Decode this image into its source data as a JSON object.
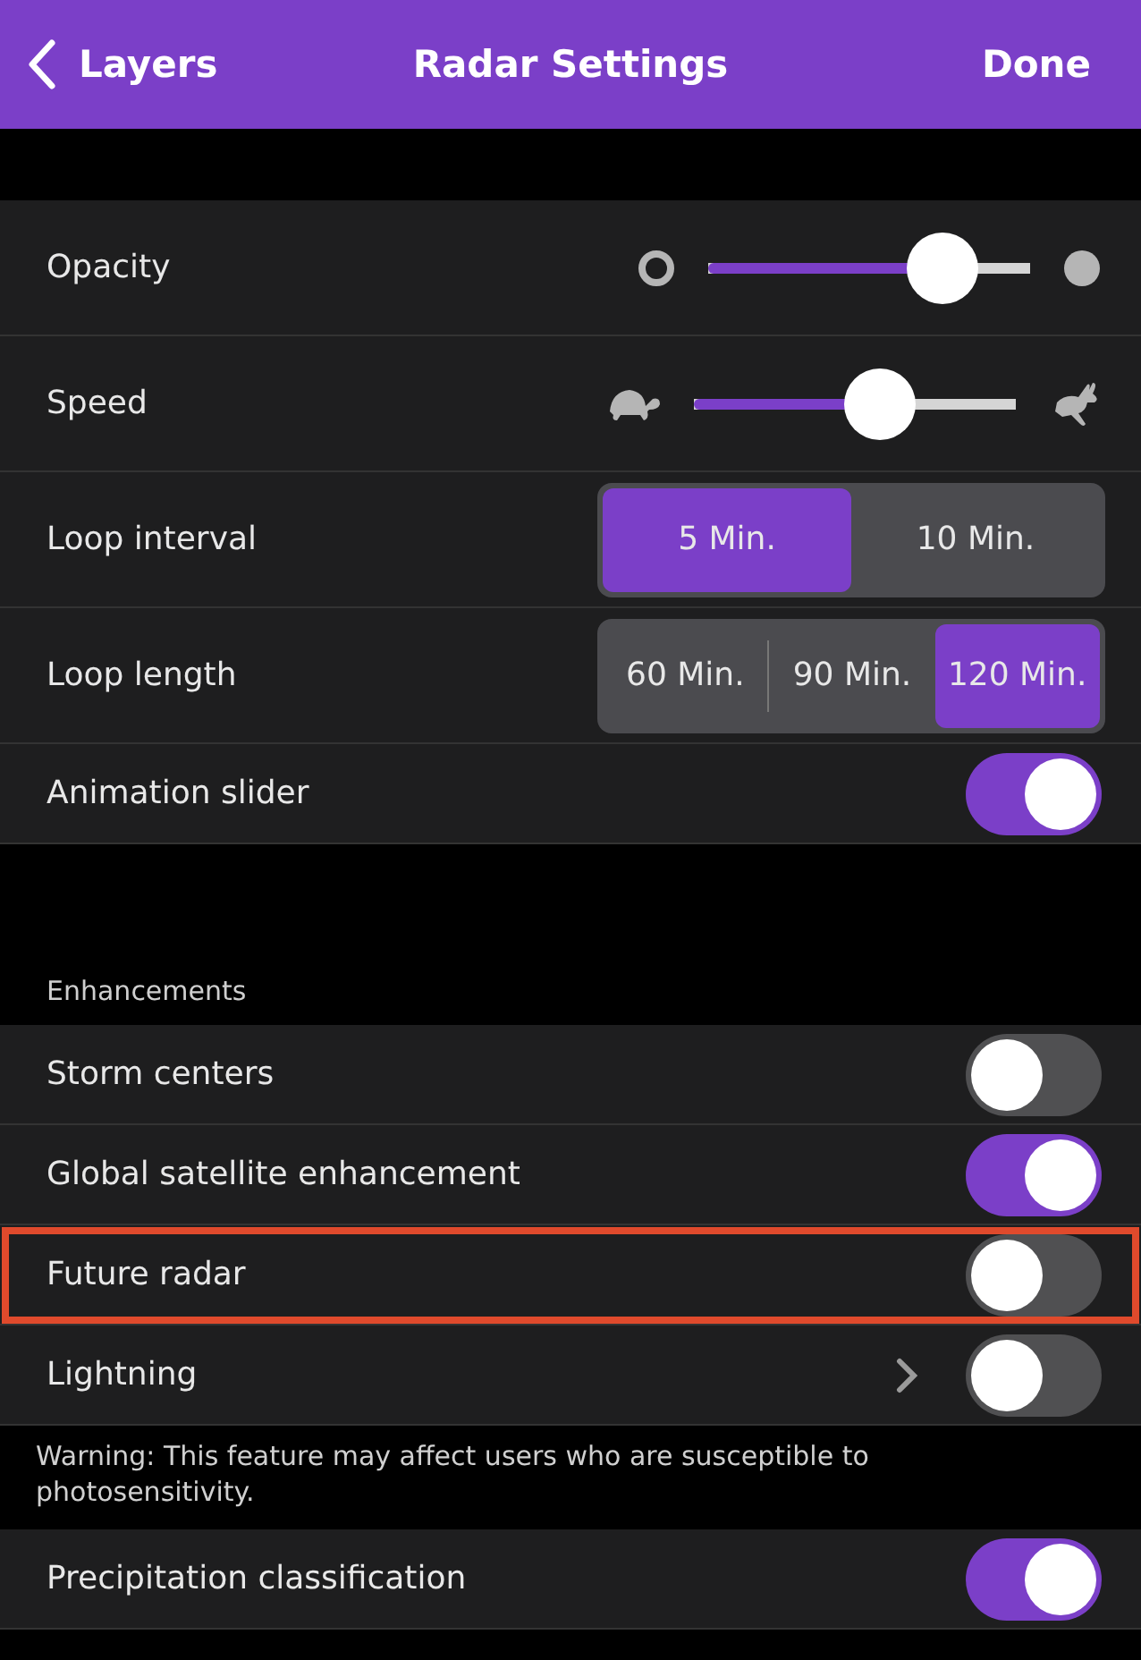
{
  "nav": {
    "back": "Layers",
    "title": "Radar Settings",
    "done": "Done"
  },
  "sections": [
    {
      "rows": [
        {
          "kind": "opacity-slider",
          "label": "Opacity",
          "level": 0.73
        },
        {
          "kind": "speed-slider",
          "label": "Speed",
          "level": 0.58
        },
        {
          "kind": "segmented",
          "label": "Loop interval",
          "options": [
            {
              "label": "5 Min.",
              "selected": true
            },
            {
              "label": "10 Min.",
              "selected": false
            }
          ]
        },
        {
          "kind": "segmented",
          "label": "Loop length",
          "options": [
            {
              "label": "60 Min.",
              "selected": false
            },
            {
              "label": "90 Min.",
              "selected": false
            },
            {
              "label": "120 Min.",
              "selected": true
            }
          ]
        },
        {
          "kind": "toggle",
          "label": "Animation slider",
          "on": true
        }
      ]
    },
    {
      "header": "Enhancements",
      "rows": [
        {
          "kind": "toggle",
          "label": "Storm centers",
          "on": false
        },
        {
          "kind": "toggle",
          "label": "Global satellite enhancement",
          "on": true
        },
        {
          "kind": "toggle",
          "label": "Future radar",
          "on": false,
          "highlighted": true
        },
        {
          "kind": "toggle",
          "label": "Lightning",
          "on": false,
          "chevron": true
        },
        {
          "kind": "note",
          "text": "Warning: This feature may affect users who are susceptible to photosensitivity."
        },
        {
          "kind": "toggle",
          "label": "Precipitation classification",
          "on": true
        }
      ]
    }
  ]
}
